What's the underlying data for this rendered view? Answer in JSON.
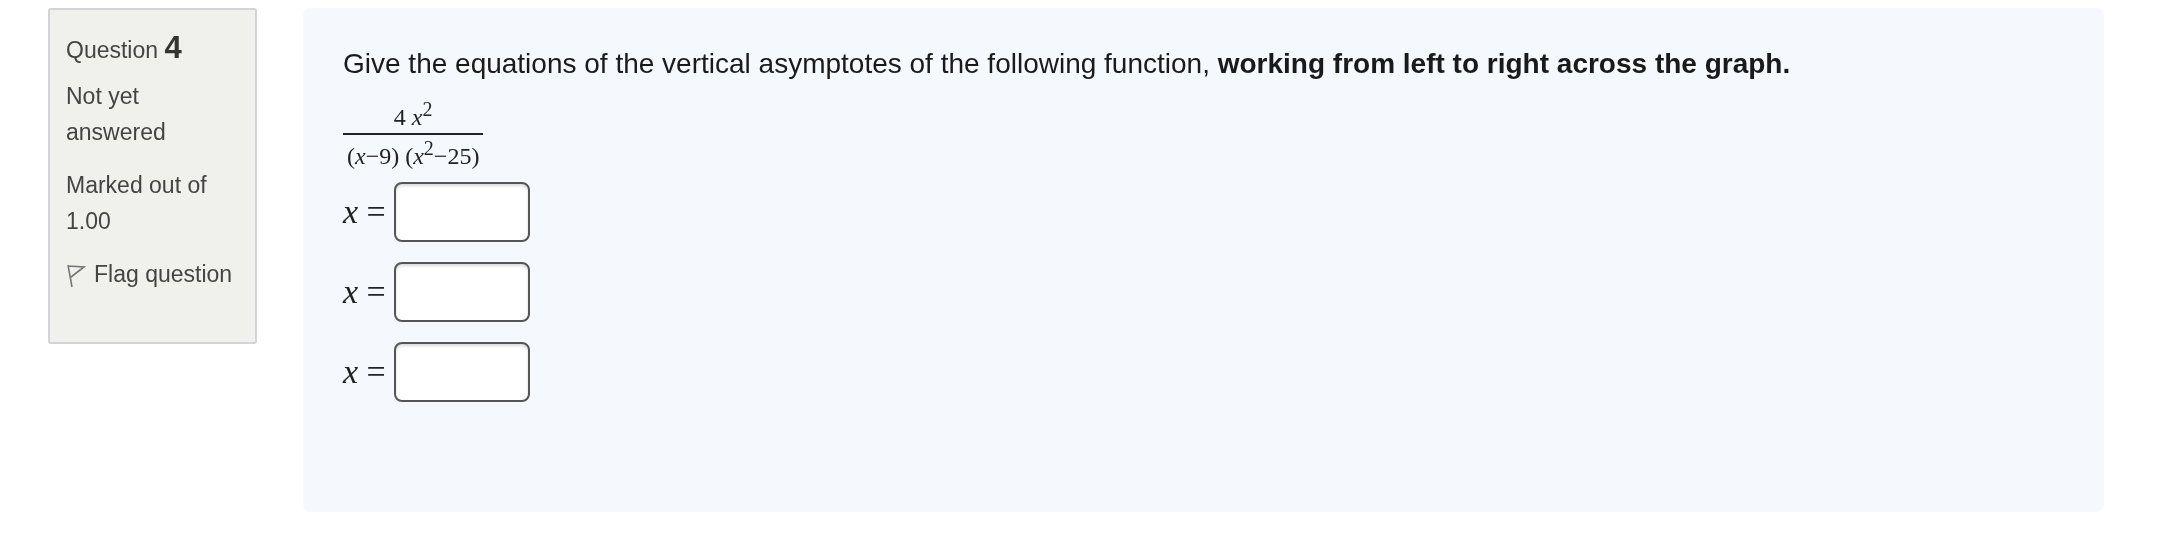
{
  "info": {
    "question_label": "Question",
    "question_number": "4",
    "status": "Not yet answered",
    "marks": "Marked out of 1.00",
    "flag": "Flag question"
  },
  "question": {
    "prompt": "Give the equations of the vertical asymptotes of the following function, **working from left to right across the graph.**",
    "numerator": "4 *x*$^{2}$",
    "denominator": "(*x*−9) (*x*$^{2}$−25)",
    "answers": [
      {
        "label": "*x* ="
      },
      {
        "label": "*x* ="
      },
      {
        "label": "*x* ="
      }
    ]
  }
}
